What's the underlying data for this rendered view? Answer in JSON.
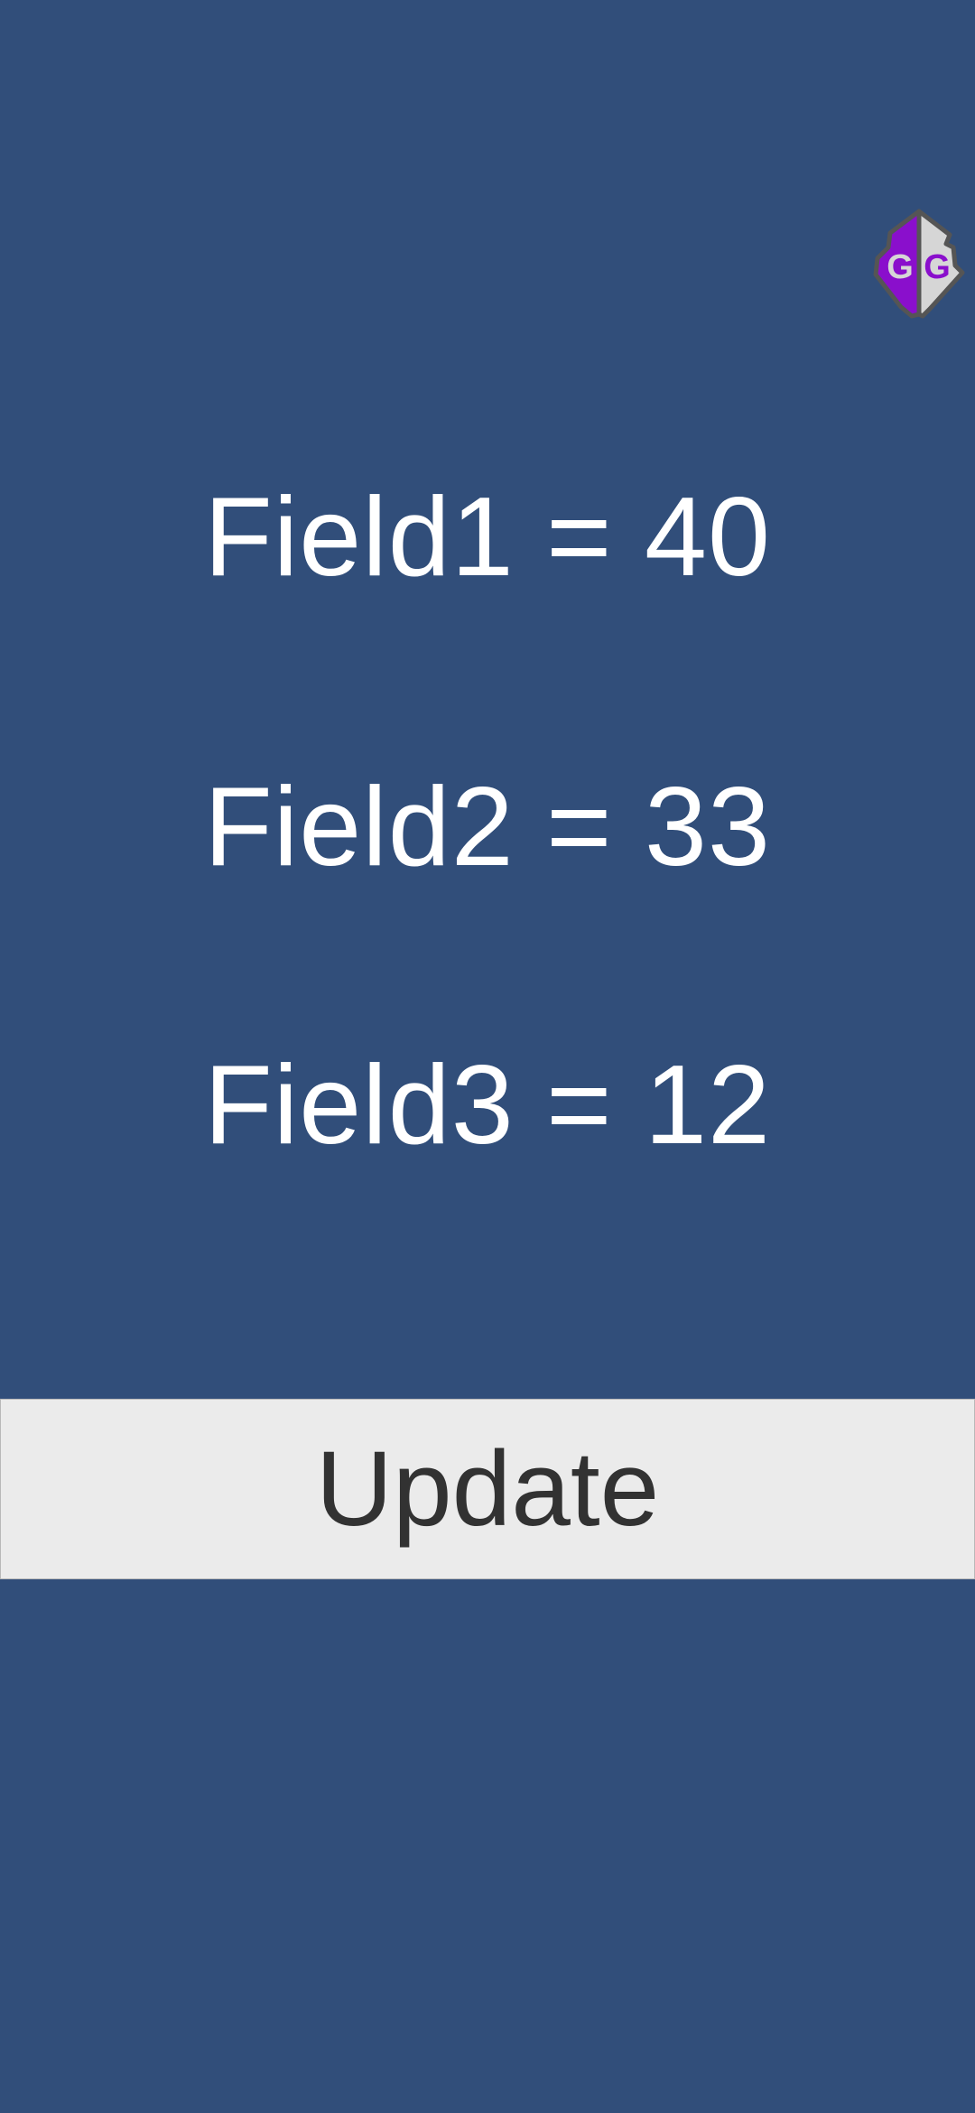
{
  "overlay": {
    "icon": "gameguardian-icon",
    "icon_text": "GG",
    "colors": {
      "left": "#8a0fcc",
      "right": "#d6d6d6",
      "outline": "#555555"
    }
  },
  "fields": [
    {
      "text": "Field1 = 40"
    },
    {
      "text": "Field2 = 33"
    },
    {
      "text": "Field3 = 12"
    }
  ],
  "update_button": {
    "label": "Update"
  },
  "colors": {
    "background": "#314e7a",
    "text": "#ffffff",
    "button_bg": "#ebebeb",
    "button_text": "#323232"
  }
}
